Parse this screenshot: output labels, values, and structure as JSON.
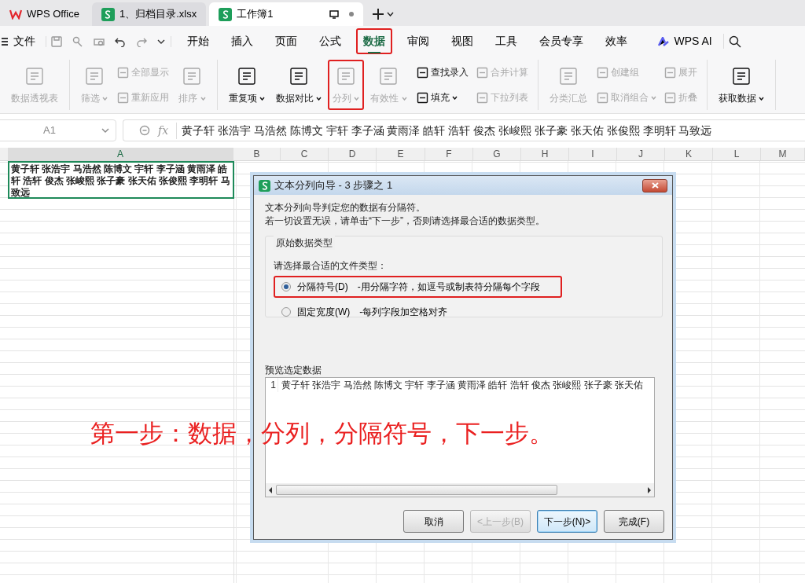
{
  "app_tabs": [
    {
      "label": "WPS Office",
      "kind": "home",
      "selected": false
    },
    {
      "label": "1、归档目录.xlsx",
      "kind": "sheet",
      "selected": false
    },
    {
      "label": "工作簿1",
      "kind": "sheet",
      "selected": true
    }
  ],
  "menu": {
    "file": "文件",
    "tabs": [
      {
        "label": "开始",
        "selected": false,
        "highlighted": false
      },
      {
        "label": "插入",
        "selected": false,
        "highlighted": false
      },
      {
        "label": "页面",
        "selected": false,
        "highlighted": false
      },
      {
        "label": "公式",
        "selected": false,
        "highlighted": false
      },
      {
        "label": "数据",
        "selected": true,
        "highlighted": true
      },
      {
        "label": "审阅",
        "selected": false,
        "highlighted": false
      },
      {
        "label": "视图",
        "selected": false,
        "highlighted": false
      },
      {
        "label": "工具",
        "selected": false,
        "highlighted": false
      },
      {
        "label": "会员专享",
        "selected": false,
        "highlighted": false
      },
      {
        "label": "效率",
        "selected": false,
        "highlighted": false
      }
    ],
    "ai": "WPS AI"
  },
  "ribbon": [
    [
      {
        "kind": "large",
        "label": "数据透视表",
        "disabled": true,
        "dropdown": false,
        "highlighted": false
      }
    ],
    [
      {
        "kind": "large",
        "label": "筛选",
        "disabled": true,
        "dropdown": true,
        "highlighted": false
      },
      {
        "kind": "stack",
        "items": [
          {
            "label": "全部显示",
            "disabled": true,
            "dropdown": false
          },
          {
            "label": "重新应用",
            "disabled": true,
            "dropdown": false
          }
        ]
      },
      {
        "kind": "large",
        "label": "排序",
        "disabled": true,
        "dropdown": true,
        "highlighted": false
      }
    ],
    [
      {
        "kind": "large",
        "label": "重复项",
        "disabled": false,
        "dropdown": true,
        "highlighted": false
      },
      {
        "kind": "large",
        "label": "数据对比",
        "disabled": false,
        "dropdown": true,
        "highlighted": false
      },
      {
        "kind": "large",
        "label": "分列",
        "disabled": true,
        "dropdown": true,
        "highlighted": true
      },
      {
        "kind": "large",
        "label": "有效性",
        "disabled": true,
        "dropdown": true,
        "highlighted": false
      },
      {
        "kind": "stack",
        "items": [
          {
            "label": "查找录入",
            "disabled": false,
            "dropdown": false
          },
          {
            "label": "填充",
            "disabled": false,
            "dropdown": true
          }
        ]
      },
      {
        "kind": "stack",
        "items": [
          {
            "label": "合并计算",
            "disabled": true,
            "dropdown": false
          },
          {
            "label": "下拉列表",
            "disabled": true,
            "dropdown": false
          }
        ]
      }
    ],
    [
      {
        "kind": "large",
        "label": "分类汇总",
        "disabled": true,
        "dropdown": false,
        "highlighted": false
      },
      {
        "kind": "stack",
        "items": [
          {
            "label": "创建组",
            "disabled": true,
            "dropdown": false
          },
          {
            "label": "取消组合",
            "disabled": true,
            "dropdown": true
          }
        ]
      },
      {
        "kind": "stack",
        "items": [
          {
            "label": "展开",
            "disabled": true,
            "dropdown": false
          },
          {
            "label": "折叠",
            "disabled": true,
            "dropdown": false
          }
        ]
      }
    ],
    [
      {
        "kind": "large",
        "label": "获取数据",
        "disabled": false,
        "dropdown": true,
        "highlighted": false
      }
    ]
  ],
  "formula_bar": {
    "cell_ref": "A1",
    "fx": "fx",
    "content": "黄子轩 张浩宇 马浩然 陈博文 宇轩 李子涵 黄雨泽 皓轩 浩轩 俊杰 张峻熙 张子豪 张天佑 张俊熙 李明轩 马致远"
  },
  "sheet": {
    "columns": [
      "A",
      "B",
      "C",
      "D",
      "E",
      "F",
      "G",
      "H",
      "I",
      "J",
      "K",
      "L",
      "M"
    ],
    "a1": "黄子轩  张浩宇  马浩然  陈博文  宇轩  李子涵  黄雨泽  皓轩  浩轩  俊杰  张峻熙  张子豪  张天佑  张俊熙  李明轩  马致远"
  },
  "dialog": {
    "title": "文本分列向导 - 3 步骤之 1",
    "intro": [
      "文本分列向导判定您的数据有分隔符。",
      "若一切设置无误，请单击“下一步”，否则请选择最合适的数据类型。"
    ],
    "group_title": "原始数据类型",
    "prompt": "请选择最合适的文件类型：",
    "options": [
      {
        "label": "分隔符号(D)",
        "description": "-用分隔字符，如逗号或制表符分隔每个字段",
        "selected": true,
        "highlighted": true
      },
      {
        "label": "固定宽度(W)",
        "description": "-每列字段加空格对齐",
        "selected": false,
        "highlighted": false
      }
    ],
    "preview_title": "预览选定数据",
    "preview_rows": [
      {
        "number": "1",
        "text": "黄子轩 张浩宇 马浩然 陈博文 宇轩 李子涵 黄雨泽 皓轩 浩轩 俊杰 张峻熙 张子豪 张天佑"
      }
    ],
    "buttons": [
      {
        "label": "取消",
        "disabled": false,
        "default": false
      },
      {
        "label": "<上一步(B)",
        "disabled": true,
        "default": false
      },
      {
        "label": "下一步(N)>",
        "disabled": false,
        "default": true
      },
      {
        "label": "完成(F)",
        "disabled": false,
        "default": false
      }
    ]
  },
  "annotation": "第一步：数据，分列，分隔符号，下一步。"
}
